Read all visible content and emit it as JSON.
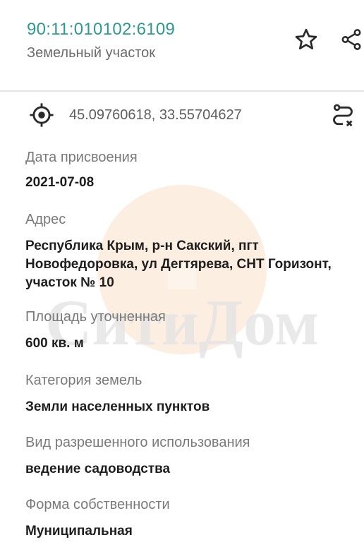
{
  "header": {
    "cadastral_number": "90:11:010102:6109",
    "object_type": "Земельный участок"
  },
  "icons": {
    "favorite": "star-icon",
    "share": "share-icon",
    "location": "target-icon",
    "route": "route-icon"
  },
  "coordinates": {
    "text": "45.09760618, 33.55704627"
  },
  "fields": [
    {
      "label": "Дата присвоения",
      "value": "2021-07-08"
    },
    {
      "label": "Адрес",
      "value": "Республика Крым, р-н Сакский, пгт Новофедоровка, ул Дегтярева, СНТ Горизонт, участок № 10"
    },
    {
      "label": "Площадь уточненная",
      "value": "600 кв. м"
    },
    {
      "label": "Категория земель",
      "value": "Земли населенных пунктов"
    },
    {
      "label": "Вид разрешенного использования",
      "value": "ведение садоводства"
    },
    {
      "label": "Форма собственности",
      "value": "Муниципальная"
    }
  ],
  "watermark": {
    "text": "СитиДом"
  },
  "colors": {
    "accent": "#2d9a92",
    "label": "#7a7a7a",
    "value": "#1e1e1e",
    "watermark_circle": "#f7d9bf",
    "watermark_text": "#e6e6e6"
  }
}
